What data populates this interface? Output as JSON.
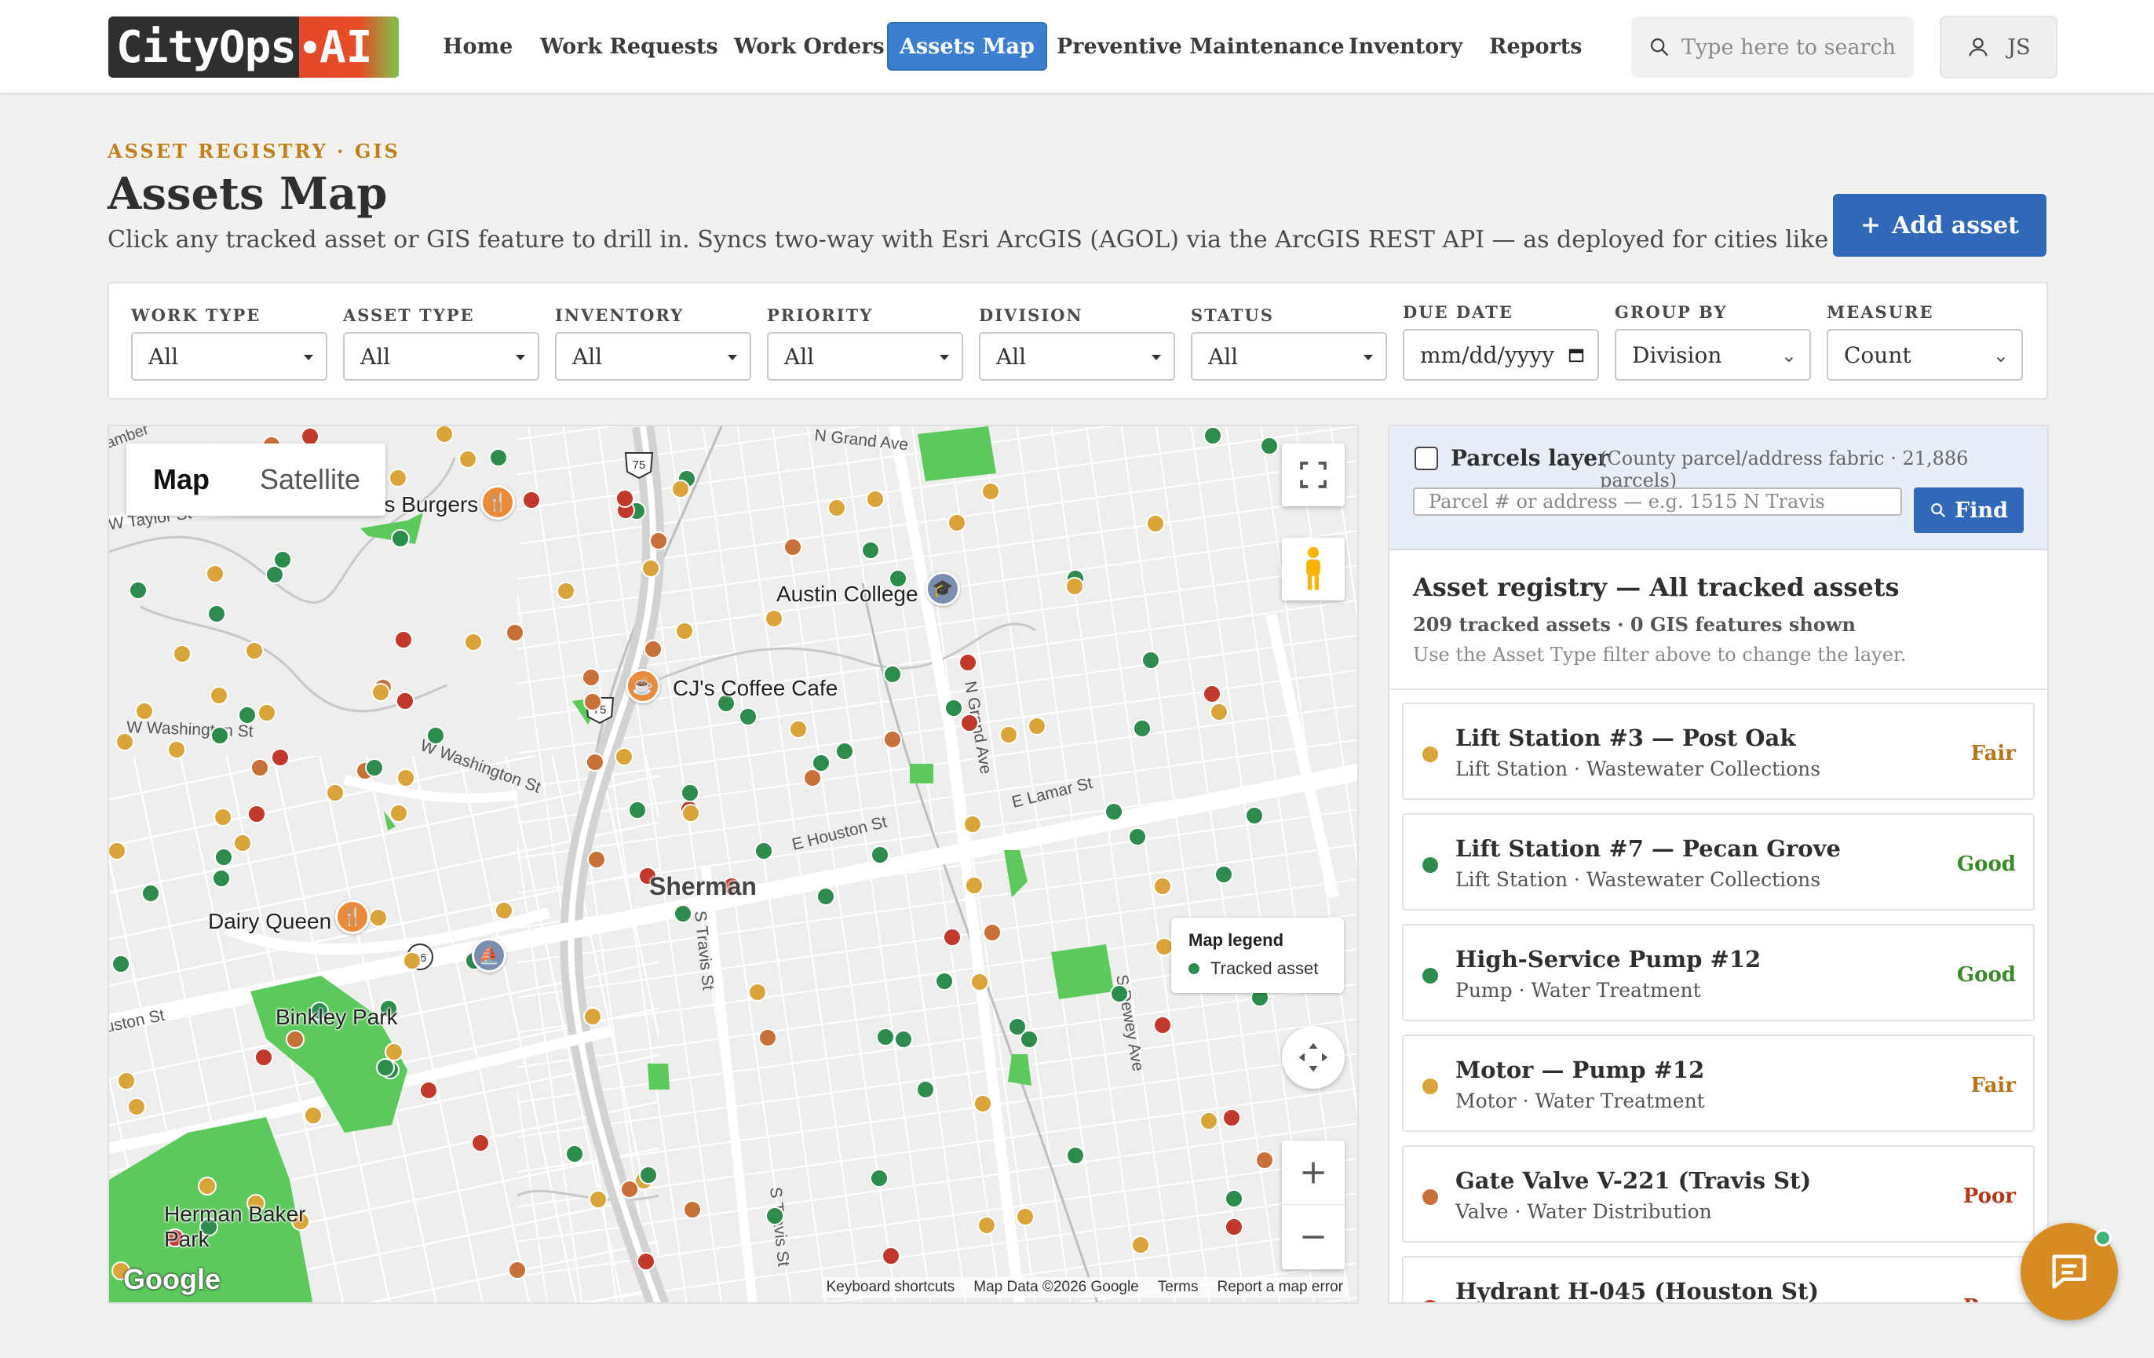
{
  "app": {
    "logo_text": "CityOps",
    "logo_ai": "AI"
  },
  "nav": {
    "home": "Home",
    "work_requests": "Work Requests",
    "work_orders": "Work Orders",
    "assets_map": "Assets Map",
    "preventive": "Preventive Maintenance",
    "inventory": "Inventory",
    "reports": "Reports"
  },
  "search": {
    "placeholder": "Type here to search"
  },
  "user": {
    "initials": "JS"
  },
  "page": {
    "eyebrow": "ASSET REGISTRY · GIS",
    "title": "Assets Map",
    "subtitle": "Click any tracked asset or GIS feature to drill in. Syncs two-way with Esri ArcGIS (AGOL) via the ArcGIS REST API — as deployed for cities like Atlanta.",
    "add_button": "Add asset"
  },
  "filters": {
    "work_type": {
      "label": "WORK TYPE",
      "value": "All"
    },
    "asset_type": {
      "label": "ASSET TYPE",
      "value": "All"
    },
    "inventory": {
      "label": "INVENTORY",
      "value": "All"
    },
    "priority": {
      "label": "PRIORITY",
      "value": "All"
    },
    "division": {
      "label": "DIVISION",
      "value": "All"
    },
    "status": {
      "label": "STATUS",
      "value": "All"
    },
    "due_date": {
      "label": "DUE DATE",
      "value": "mm/dd/yyyy"
    },
    "group_by": {
      "label": "GROUP BY",
      "value": "Division"
    },
    "measure": {
      "label": "MEASURE",
      "value": "Count"
    }
  },
  "map": {
    "map_tab": "Map",
    "satellite_tab": "Satellite",
    "legend_title": "Map legend",
    "legend_item": "Tracked asset",
    "footer": {
      "shortcuts": "Keyboard shortcuts",
      "data": "Map Data ©2026 Google",
      "terms": "Terms",
      "report": "Report a map error"
    },
    "google": "Google",
    "places": {
      "burgers": "MG's Burgers",
      "college": "Austin College",
      "coffee": "CJ's Coffee Cafe",
      "dairy": "Dairy Queen",
      "binkley": "Binkley Park",
      "herman": "Herman Baker Park",
      "sherman": "Sherman"
    },
    "streets": {
      "taylor": "W Taylor St",
      "washington": "W Washington St",
      "washington2": "W Washington St",
      "grand": "N Grand Ave",
      "grand2": "N Grand Ave",
      "lamar": "E Lamar St",
      "houston": "E Houston St",
      "houston_w": "Houston St",
      "travis": "S Travis St",
      "travis2": "S Travis St",
      "dewey": "S Dewey Ave",
      "lamb": "Lamber"
    },
    "shields": {
      "us75a": "75",
      "us75b": "75",
      "sh56": "56"
    },
    "colors": {
      "good": "#2e8b4e",
      "fair": "#d9a43a",
      "poor": "#c0392b",
      "orange": "#c8703a",
      "park": "#5cc95c"
    }
  },
  "panel": {
    "parcels_label": "Parcels layer",
    "parcels_note": "(County parcel/address fabric · 21,886 parcels)",
    "parcel_placeholder": "Parcel # or address — e.g. 1515 N Travis",
    "find": "Find",
    "registry_title": "Asset registry — All tracked assets",
    "registry_count": "209 tracked assets · 0 GIS features shown",
    "registry_hint": "Use the Asset Type filter above to change the layer.",
    "assets": [
      {
        "name": "Lift Station #3 — Post Oak",
        "sub": "Lift Station · Wastewater Collections",
        "status": "Fair",
        "color": "#d9a43a",
        "status_color": "#b8741a"
      },
      {
        "name": "Lift Station #7 — Pecan Grove",
        "sub": "Lift Station · Wastewater Collections",
        "status": "Good",
        "color": "#2e8b4e",
        "status_color": "#3a8a2a"
      },
      {
        "name": "High-Service Pump #12",
        "sub": "Pump · Water Treatment",
        "status": "Good",
        "color": "#2e8b4e",
        "status_color": "#3a8a2a"
      },
      {
        "name": "Motor — Pump #12",
        "sub": "Motor · Water Treatment",
        "status": "Fair",
        "color": "#d9a43a",
        "status_color": "#b8741a"
      },
      {
        "name": "Gate Valve V-221 (Travis St)",
        "sub": "Valve · Water Distribution",
        "status": "Poor",
        "color": "#c8703a",
        "status_color": "#b23a1a"
      },
      {
        "name": "Hydrant H-045 (Houston St)",
        "sub": "",
        "status": "Poor",
        "color": "#c0392b",
        "status_color": "#b23a1a"
      }
    ]
  }
}
